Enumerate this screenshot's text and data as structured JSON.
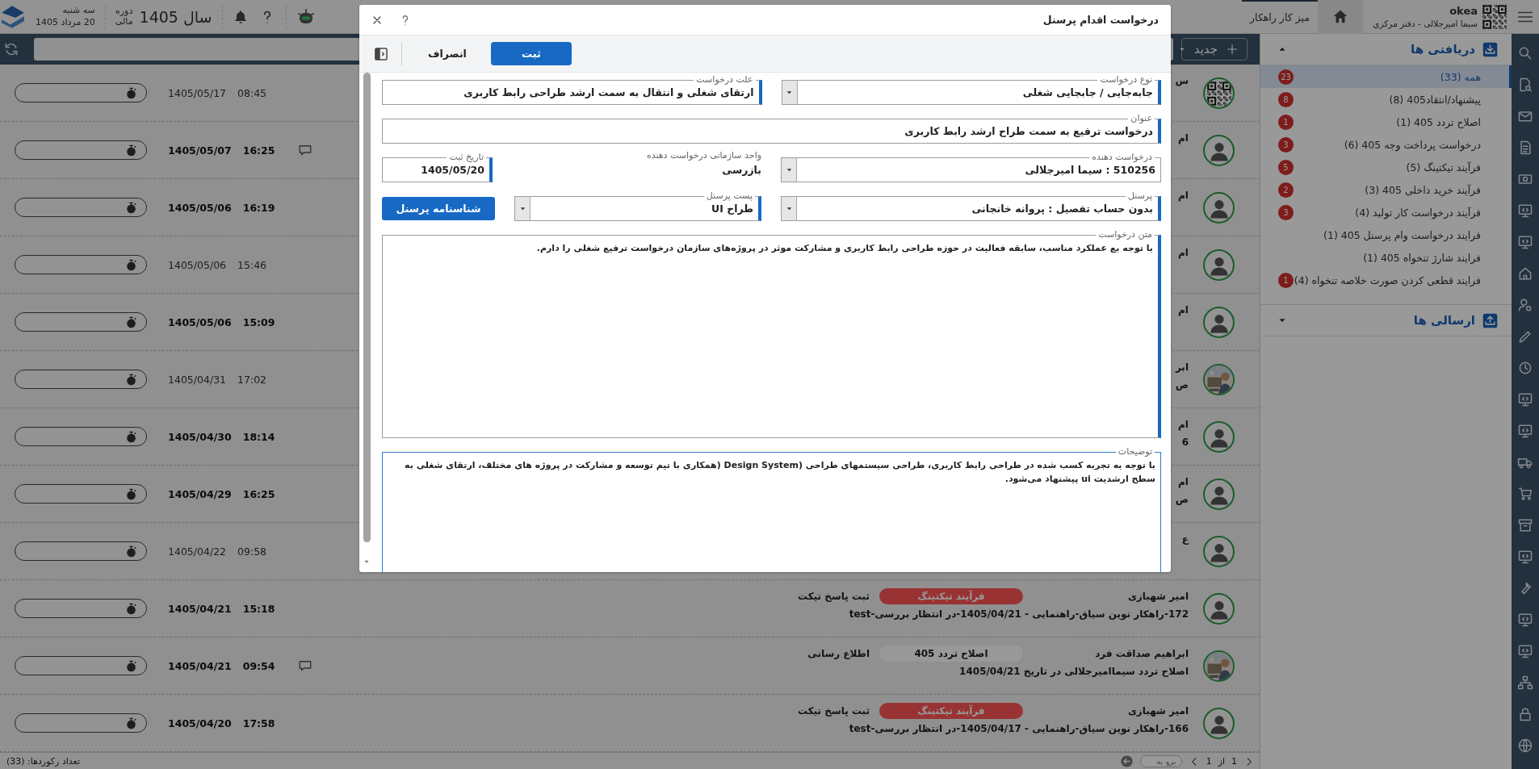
{
  "topbar": {
    "weekday": "سه شنبه",
    "date": "20 مرداد 1405",
    "fiscal_label": "دوره مالی",
    "year": "سال 1405",
    "user_name": "okea",
    "user_subtitle": "سیما امیرجلالی - دفتر مرکزی",
    "workspace_tab": "میز کار راهکار"
  },
  "sidebar": {
    "inbox": {
      "title": "دریافتی ها",
      "expanded": true,
      "items": [
        {
          "label": "همه (33)",
          "badge": "23",
          "selected": true
        },
        {
          "label": "پیشنهاد/انتقاد405 (8)",
          "badge": "8",
          "selected": false
        },
        {
          "label": "اصلاح تردد 405 (1)",
          "badge": "1",
          "selected": false
        },
        {
          "label": "درخواست پرداخت وجه 405 (6)",
          "badge": "3",
          "selected": false
        },
        {
          "label": "فرآیند تیکتینگ (5)",
          "badge": "5",
          "selected": false
        },
        {
          "label": "فرآیند خرید داخلی 405 (3)",
          "badge": "2",
          "selected": false
        },
        {
          "label": "فرآیند درخواست کار تولید (4)",
          "badge": "3",
          "selected": false
        },
        {
          "label": "فرایند درخواست وام پرسنل 405 (1)",
          "selected": false
        },
        {
          "label": "فرایند شارژ تنخواه 405 (1)",
          "selected": false
        },
        {
          "label": "فرایند قطعی کردن صورت خلاصه تنخواه (4)",
          "badge": "1",
          "selected": false
        }
      ]
    },
    "outbox": {
      "title": "ارسالی ها",
      "expanded": false
    }
  },
  "list_toolbar": {
    "new_button": "جدید"
  },
  "messages": [
    {
      "name": "س",
      "avatar": {
        "kind": "qr"
      },
      "date": "1405/05/17",
      "time": "08:45",
      "unread": false,
      "has_comment": false
    },
    {
      "name": "ام",
      "avatar": {
        "kind": "person"
      },
      "date": "1405/05/07",
      "time": "16:25",
      "unread": true,
      "has_comment": true
    },
    {
      "name": "ام",
      "avatar": {
        "kind": "person"
      },
      "date": "1405/05/06",
      "time": "16:19",
      "unread": true,
      "has_comment": false
    },
    {
      "name": "ام",
      "avatar": {
        "kind": "person"
      },
      "date": "1405/05/06",
      "time": "15:46",
      "unread": false,
      "has_comment": false
    },
    {
      "name": "ام",
      "avatar": {
        "kind": "person"
      },
      "date": "1405/05/06",
      "time": "15:09",
      "unread": true,
      "has_comment": false
    },
    {
      "name": "ابر",
      "subject": "ص",
      "date": "1405/04/31",
      "time": "17:02",
      "unread": false,
      "has_comment": false
    },
    {
      "name": "ام",
      "subject": "6",
      "avatar": {
        "kind": "person"
      },
      "date": "1405/04/30",
      "time": "18:14",
      "unread": true,
      "has_comment": false
    },
    {
      "name": "ام",
      "subject": "ص",
      "avatar": {
        "kind": "person"
      },
      "date": "1405/04/29",
      "time": "16:25",
      "unread": true,
      "has_comment": false
    },
    {
      "name": "ع",
      "avatar": {
        "kind": "person"
      },
      "date": "1405/04/22",
      "time": "09:58",
      "unread": false,
      "has_comment": false
    },
    {
      "name": "امیر شهبازی",
      "tag": {
        "label": "فرآیند تیکتینگ",
        "color": "#993333"
      },
      "action": "ثبت پاسخ تیکت",
      "subject": "172-راهکار نوین سیاق-راهنمایی - 1405/04/21-در انتظار بررسی-test",
      "avatar": {
        "kind": "person"
      },
      "date": "1405/04/21",
      "time": "15:18",
      "unread": true,
      "has_comment": false
    },
    {
      "name": "ابراهیم صداقت فرد",
      "tag": {
        "label": "اصلاح تردد 405",
        "color": "#999999"
      },
      "action": "اطلاع رسانی",
      "subject": "اصلاح تردد سیماامیرجلالی در تاریخ 1405/04/21",
      "date": "1405/04/21",
      "time": "09:54",
      "unread": true,
      "has_comment": true
    },
    {
      "name": "امیر شهبازی",
      "tag": {
        "label": "فرآیند تیکتینگ",
        "color": "#993333"
      },
      "action": "ثبت پاسخ تیکت",
      "subject": "166-راهکار نوین سیاق-راهنمایی - 1405/04/17-در انتظار بررسی-test",
      "avatar": {
        "kind": "person"
      },
      "date": "1405/04/20",
      "time": "17:58",
      "unread": true,
      "has_comment": false
    }
  ],
  "footer": {
    "record_count": "تعداد رکوردها: (33)",
    "page": "1",
    "of": "از",
    "total_pages": "1",
    "goto_placeholder": "برو به"
  },
  "dialog": {
    "title": "درخواست اقدام پرسنل",
    "submit_button": "ثبت",
    "cancel_button": "انصراف",
    "rows": [
      [
        {
          "kind": "select",
          "label": "نوع درخواست",
          "value": "جابه‌جایی / جابجایی شغلی",
          "required": true
        },
        {
          "kind": "text",
          "label": "علت درخواست",
          "value": "ارتقای شغلی و انتقال به سمت ارشد طراحی رابط کاربری",
          "required": true
        }
      ],
      [
        {
          "kind": "text",
          "label": "عنوان",
          "value": "درخواست ترفیع به سمت طراح ارشد رابط کاربری",
          "required": true
        }
      ],
      [
        {
          "kind": "select",
          "label": "درخواست دهنده",
          "value": "510256 : سیما امیرجلالی",
          "required": false
        },
        {
          "kind": "static",
          "label": "واحد سازمانی درخواست دهنده",
          "value": "بازرسی"
        },
        {
          "kind": "text",
          "label": "تاریخ ثبت",
          "value": "1405/05/20",
          "required": true
        }
      ],
      [
        {
          "kind": "select",
          "label": "پرسنل",
          "value": "بدون حساب تفصیل : پروانه خانجانی",
          "required": true
        },
        {
          "kind": "select",
          "label": "پست پرسنل",
          "value": "طراح UI",
          "required": true
        },
        {
          "kind": "button",
          "label": "شناسنامه پرسنل"
        }
      ],
      [
        {
          "kind": "textarea",
          "label": "متن درخواست",
          "value": "با توجه بع عملکرد مناسب، سابقه فعالیت در حوزه طراحی رابط کاربری و مشارکت موثر در پروژه‌های سازمان درخواست ترفیع شغلی را دارم.",
          "required": true,
          "focused": false
        }
      ],
      [
        {
          "kind": "textarea",
          "label": "توضیحات",
          "value": "با توجه به تجربه کسب شده در طراحی رابط کاربری، طراحی سیستمهای طراحی (Design System (همکاری با تیم توسعه و مشارکت در پروژه های مختلف، ارتقای شغلی به سطح ارشدیت ui پیشنهاد می‌شود.",
          "required": false,
          "focused": true
        }
      ]
    ]
  }
}
